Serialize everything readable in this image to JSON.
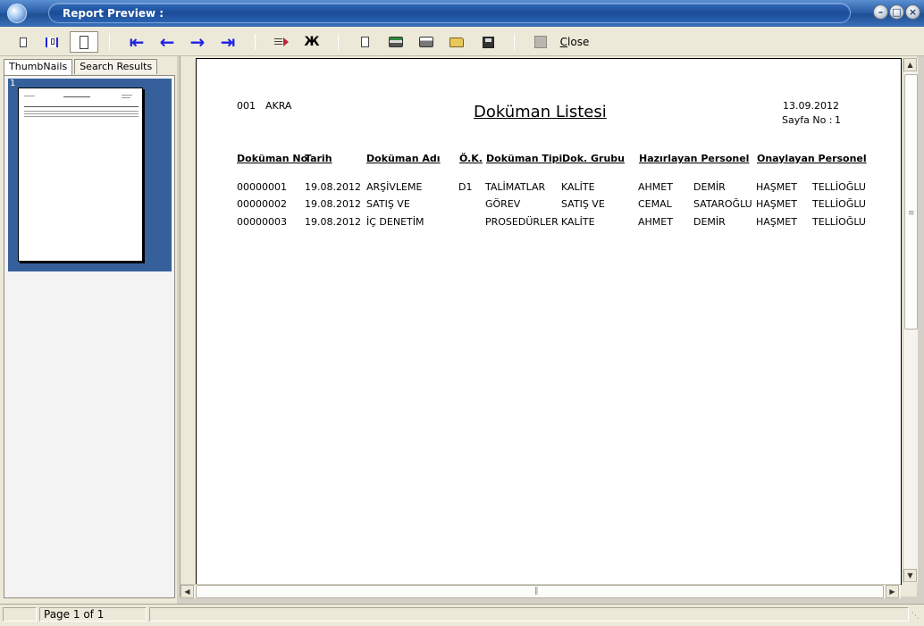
{
  "window": {
    "title": "Report Preview :"
  },
  "toolbar": {
    "icons": [
      "single-page-icon",
      "page-width-icon",
      "full-page-icon",
      "first-page-icon",
      "prev-page-icon",
      "next-page-icon",
      "last-page-icon",
      "go-to-page-icon",
      "find-icon",
      "page-setup-icon",
      "print-setup-icon",
      "print-icon",
      "open-icon",
      "save-icon",
      "close-icon"
    ],
    "close_label": "Close",
    "close_accel": "C",
    "close_rest": "lose"
  },
  "left_panel": {
    "tabs": [
      {
        "label": "ThumbNails",
        "active": true
      },
      {
        "label": "Search Results",
        "active": false
      }
    ],
    "thumbnail_number": "1"
  },
  "report": {
    "company_code": "001",
    "company_name": "AKRA",
    "title": "Doküman Listesi",
    "date": "13.09.2012",
    "page_label": "Sayfa No :",
    "page_no": "1",
    "columns": [
      "Doküman No",
      "Tarih",
      "Doküman Adı",
      "Ö.K.",
      "Doküman Tipi",
      "Dok. Grubu",
      "Hazırlayan Personel",
      "Onaylayan Personel"
    ],
    "rows": [
      {
        "no": "00000001",
        "date": "19.08.2012",
        "name": "ARŞİVLEME",
        "ok": "D1",
        "type": "TALİMATLAR",
        "group": "KALİTE",
        "prep_first": "AHMET",
        "prep_last": "DEMİR",
        "appr_first": "HAŞMET",
        "appr_last": "TELLİOĞLU"
      },
      {
        "no": "00000002",
        "date": "19.08.2012",
        "name": "SATIŞ VE",
        "ok": "",
        "type": "GÖREV",
        "group": "SATIŞ VE",
        "prep_first": "CEMAL",
        "prep_last": "SATAROĞLU",
        "appr_first": "HAŞMET",
        "appr_last": "TELLİOĞLU"
      },
      {
        "no": "00000003",
        "date": "19.08.2012",
        "name": "İÇ DENETİM",
        "ok": "",
        "type": "PROSEDÜRLER",
        "group": "KALİTE",
        "prep_first": "AHMET",
        "prep_last": "DEMİR",
        "appr_first": "HAŞMET",
        "appr_last": "TELLİOĞLU"
      }
    ]
  },
  "status": {
    "page_info": "Page 1 of 1"
  },
  "colors": {
    "title_bar": "#2a5fa8",
    "thumb_selection": "#35609c",
    "nav_arrow": "#1e22e6"
  }
}
